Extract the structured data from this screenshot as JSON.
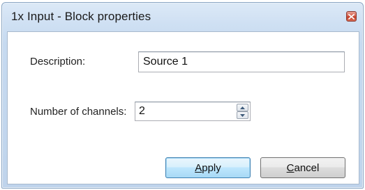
{
  "window": {
    "title": "1x Input - Block properties",
    "accent_color": "#c6daf0",
    "close_button_color": "#c3412c"
  },
  "form": {
    "description_label": "Description:",
    "description_value": "Source 1",
    "channels_label": "Number of channels:",
    "channels_value": "2"
  },
  "buttons": {
    "apply_mnemonic": "A",
    "apply_rest": "pply",
    "cancel_mnemonic": "C",
    "cancel_rest": "ancel"
  },
  "icons": {
    "close": "close-icon",
    "spin_up": "arrow-up-icon",
    "spin_down": "arrow-down-icon"
  }
}
